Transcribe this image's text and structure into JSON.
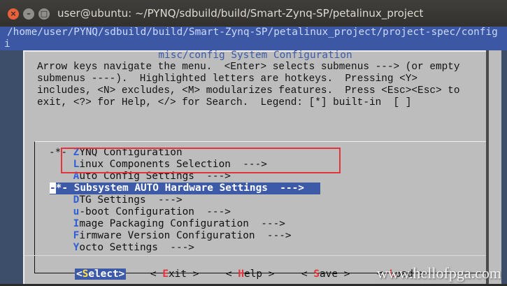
{
  "window": {
    "title": "user@ubuntu: ~/PYNQ/sdbuild/build/Smart-Zynq-SP/petalinux_project",
    "close_glyph": "×",
    "min_glyph": "–",
    "max_glyph": "□"
  },
  "terminal": {
    "path_line1": "/home/user/PYNQ/sdbuild/build/Smart-Zynq-SP/petalinux_project/project-spec/config",
    "path_line2": "i"
  },
  "dialog": {
    "title": "misc/config System Configuration",
    "help_text": "Arrow keys navigate the menu.  <Enter> selects submenus ---> (or empty\nsubmenus ----).  Highlighted letters are hotkeys.  Pressing <Y>\nincludes, <N> excludes, <M> modularizes features.  Press <Esc><Esc> to\nexit, <?> for Help, </> for Search.  Legend: [*] built-in  [ ]"
  },
  "menu": {
    "items": [
      {
        "prefix": "-*- ",
        "hotkey": "Z",
        "rest": "YNQ Configuration"
      },
      {
        "prefix": "    ",
        "hotkey": "L",
        "rest": "inux Components Selection  --->"
      },
      {
        "prefix": "    ",
        "hotkey": "A",
        "rest": "uto Config Settings  --->"
      },
      {
        "cursor": "-",
        "prefix": "*- ",
        "hotkey": "S",
        "rest": "ubsystem AUTO Hardware Settings  --->"
      },
      {
        "prefix": "    ",
        "hotkey": "D",
        "rest": "TG Settings  --->"
      },
      {
        "prefix": "    ",
        "hotkey": "u",
        "rest": "-boot Configuration  --->"
      },
      {
        "prefix": "    ",
        "hotkey": "I",
        "rest": "mage Packaging Configuration  --->"
      },
      {
        "prefix": "    ",
        "hotkey": "F",
        "rest": "irmware Version Configuration  --->"
      },
      {
        "prefix": "    ",
        "hotkey": "Y",
        "rest": "octo Settings  --->"
      }
    ]
  },
  "buttons": [
    {
      "pre": "<",
      "hotkey": "S",
      "post": "elect>"
    },
    {
      "pre": "< ",
      "hotkey": "E",
      "post": "xit >"
    },
    {
      "pre": "< ",
      "hotkey": "H",
      "post": "elp >"
    },
    {
      "pre": "< ",
      "hotkey": "S",
      "post": "ave >"
    },
    {
      "pre": "< ",
      "hotkey": "L",
      "post": "oad >"
    }
  ],
  "watermark": "www.hellofpga.com"
}
